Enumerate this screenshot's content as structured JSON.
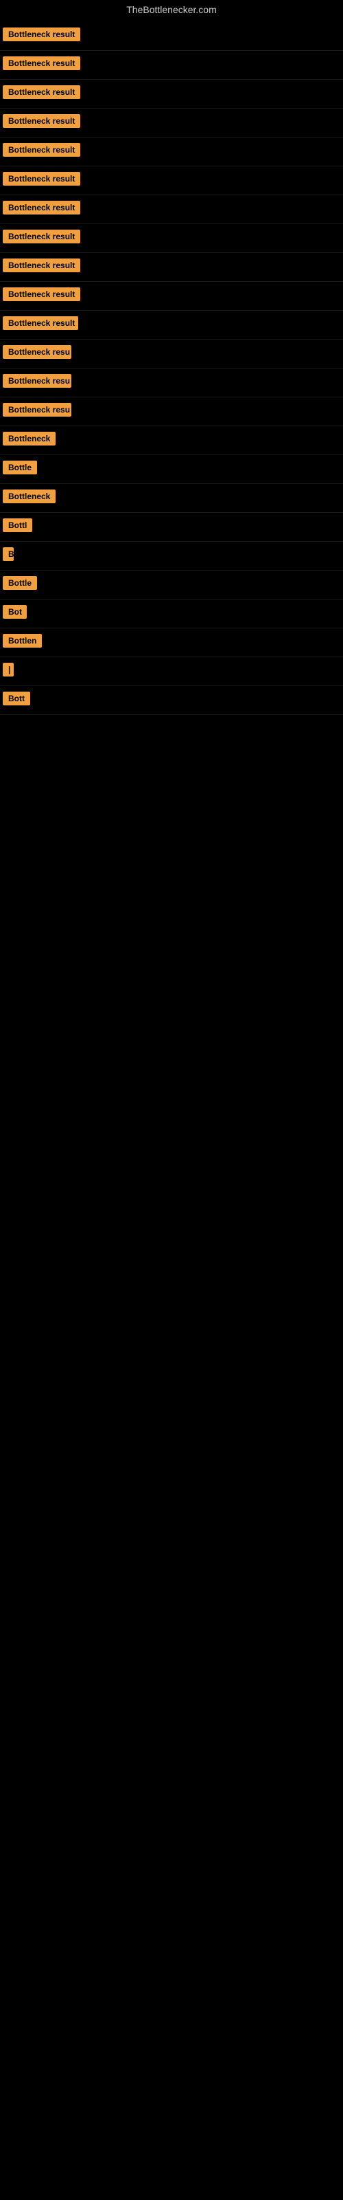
{
  "site": {
    "title": "TheBottlenecker.com"
  },
  "rows": [
    {
      "id": 1,
      "label": "Bottleneck result",
      "width": 120
    },
    {
      "id": 2,
      "label": "Bottleneck result",
      "width": 120
    },
    {
      "id": 3,
      "label": "Bottleneck result",
      "width": 120
    },
    {
      "id": 4,
      "label": "Bottleneck result",
      "width": 120
    },
    {
      "id": 5,
      "label": "Bottleneck result",
      "width": 120
    },
    {
      "id": 6,
      "label": "Bottleneck result",
      "width": 120
    },
    {
      "id": 7,
      "label": "Bottleneck result",
      "width": 120
    },
    {
      "id": 8,
      "label": "Bottleneck result",
      "width": 120
    },
    {
      "id": 9,
      "label": "Bottleneck result",
      "width": 120
    },
    {
      "id": 10,
      "label": "Bottleneck result",
      "width": 120
    },
    {
      "id": 11,
      "label": "Bottleneck result",
      "width": 110
    },
    {
      "id": 12,
      "label": "Bottleneck resu",
      "width": 100
    },
    {
      "id": 13,
      "label": "Bottleneck resu",
      "width": 100
    },
    {
      "id": 14,
      "label": "Bottleneck resu",
      "width": 100
    },
    {
      "id": 15,
      "label": "Bottleneck",
      "width": 80
    },
    {
      "id": 16,
      "label": "Bottle",
      "width": 55
    },
    {
      "id": 17,
      "label": "Bottleneck",
      "width": 80
    },
    {
      "id": 18,
      "label": "Bottl",
      "width": 45
    },
    {
      "id": 19,
      "label": "B",
      "width": 16
    },
    {
      "id": 20,
      "label": "Bottle",
      "width": 55
    },
    {
      "id": 21,
      "label": "Bot",
      "width": 35
    },
    {
      "id": 22,
      "label": "Bottlen",
      "width": 65
    },
    {
      "id": 23,
      "label": "|",
      "width": 10
    },
    {
      "id": 24,
      "label": "Bott",
      "width": 40
    }
  ]
}
